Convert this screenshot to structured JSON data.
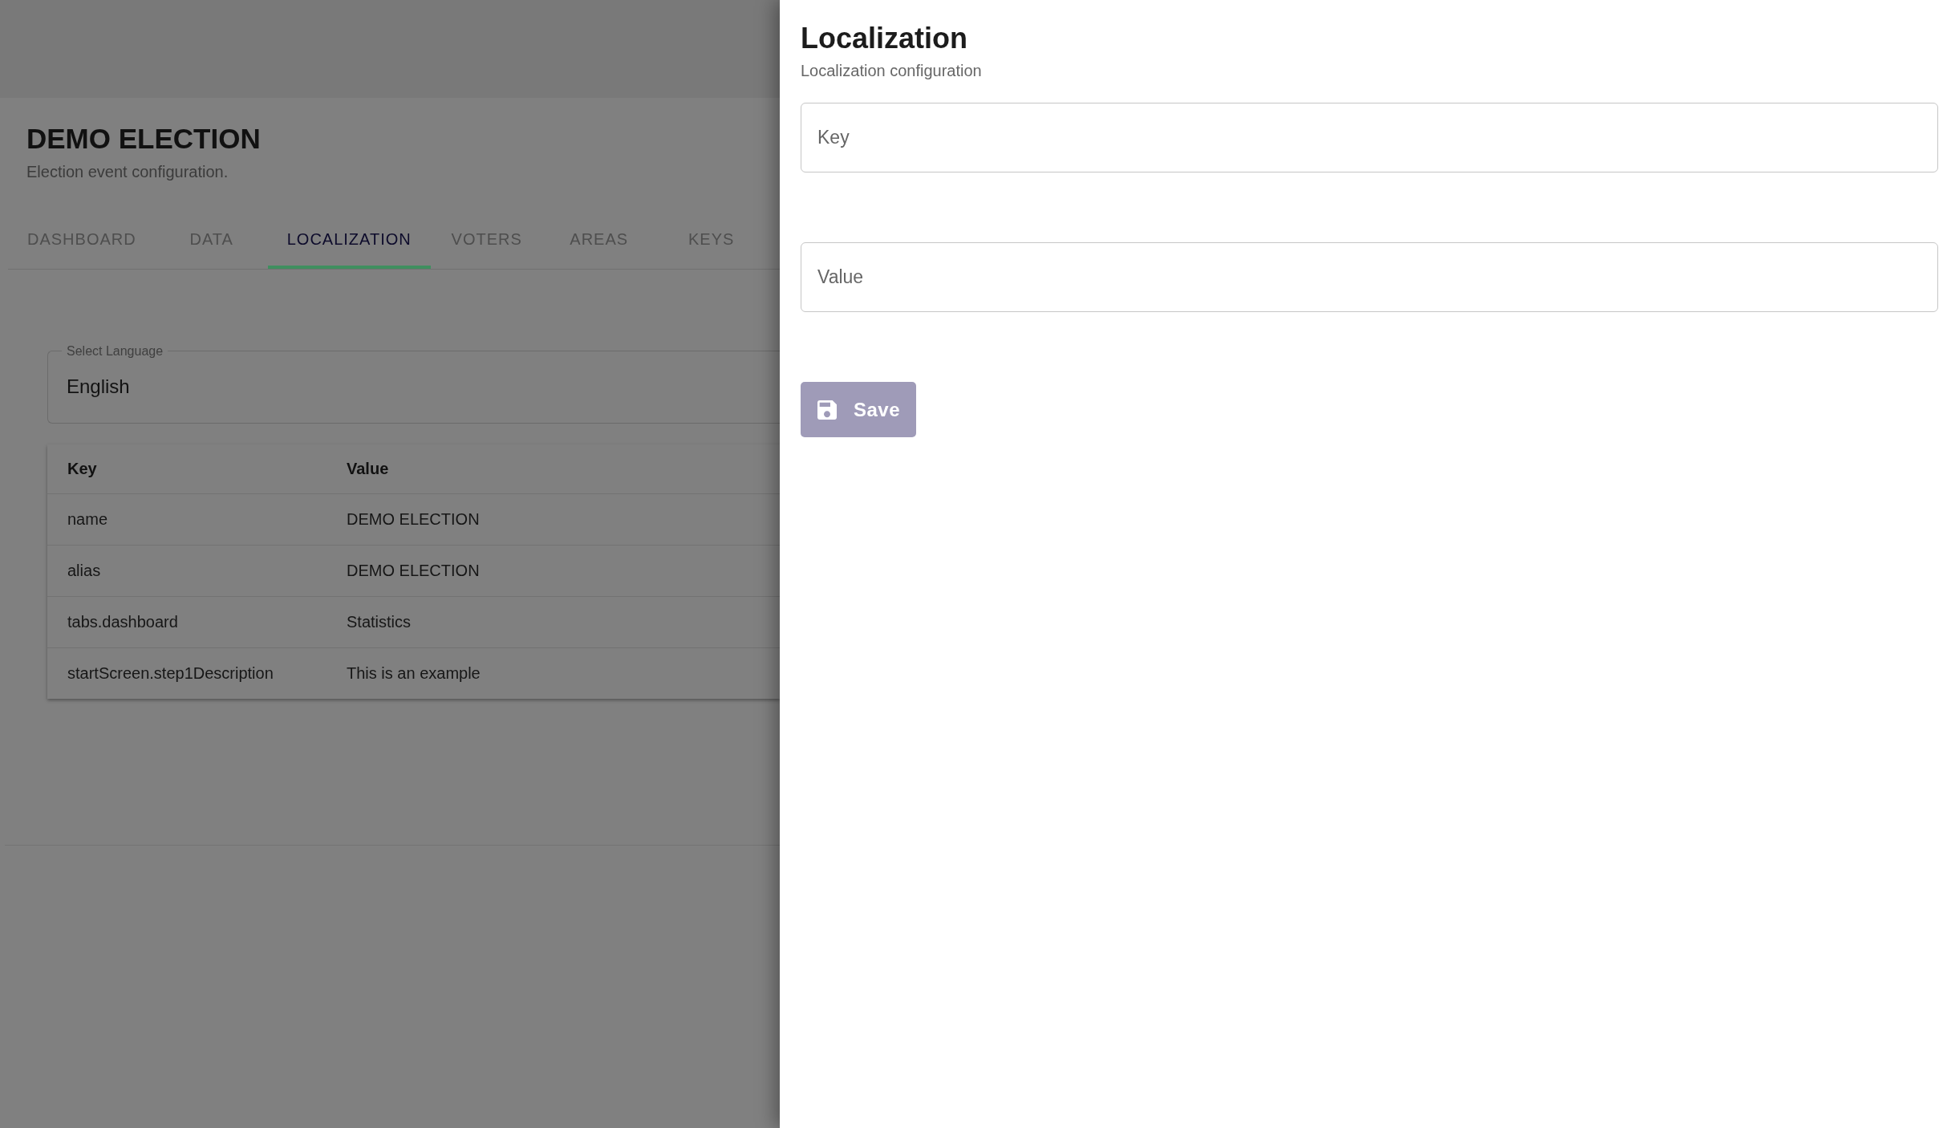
{
  "page": {
    "title": "DEMO ELECTION",
    "subtitle": "Election event configuration.",
    "tabs": [
      {
        "label": "DASHBOARD",
        "selected": false
      },
      {
        "label": "DATA",
        "selected": false
      },
      {
        "label": "LOCALIZATION",
        "selected": true
      },
      {
        "label": "VOTERS",
        "selected": false
      },
      {
        "label": "AREAS",
        "selected": false
      },
      {
        "label": "KEYS",
        "selected": false
      }
    ],
    "language_select": {
      "label": "Select Language",
      "value": "English"
    },
    "table": {
      "columns": [
        "Key",
        "Value"
      ],
      "rows": [
        [
          "name",
          "DEMO ELECTION"
        ],
        [
          "alias",
          "DEMO ELECTION"
        ],
        [
          "tabs.dashboard",
          "Statistics"
        ],
        [
          "startScreen.step1Description",
          "This is an example"
        ]
      ]
    }
  },
  "drawer": {
    "title": "Localization",
    "subtitle": "Localization configuration",
    "fields": [
      {
        "placeholder": "Key"
      },
      {
        "placeholder": "Value"
      }
    ],
    "save_button": {
      "label": "Save",
      "disabled": true
    }
  }
}
